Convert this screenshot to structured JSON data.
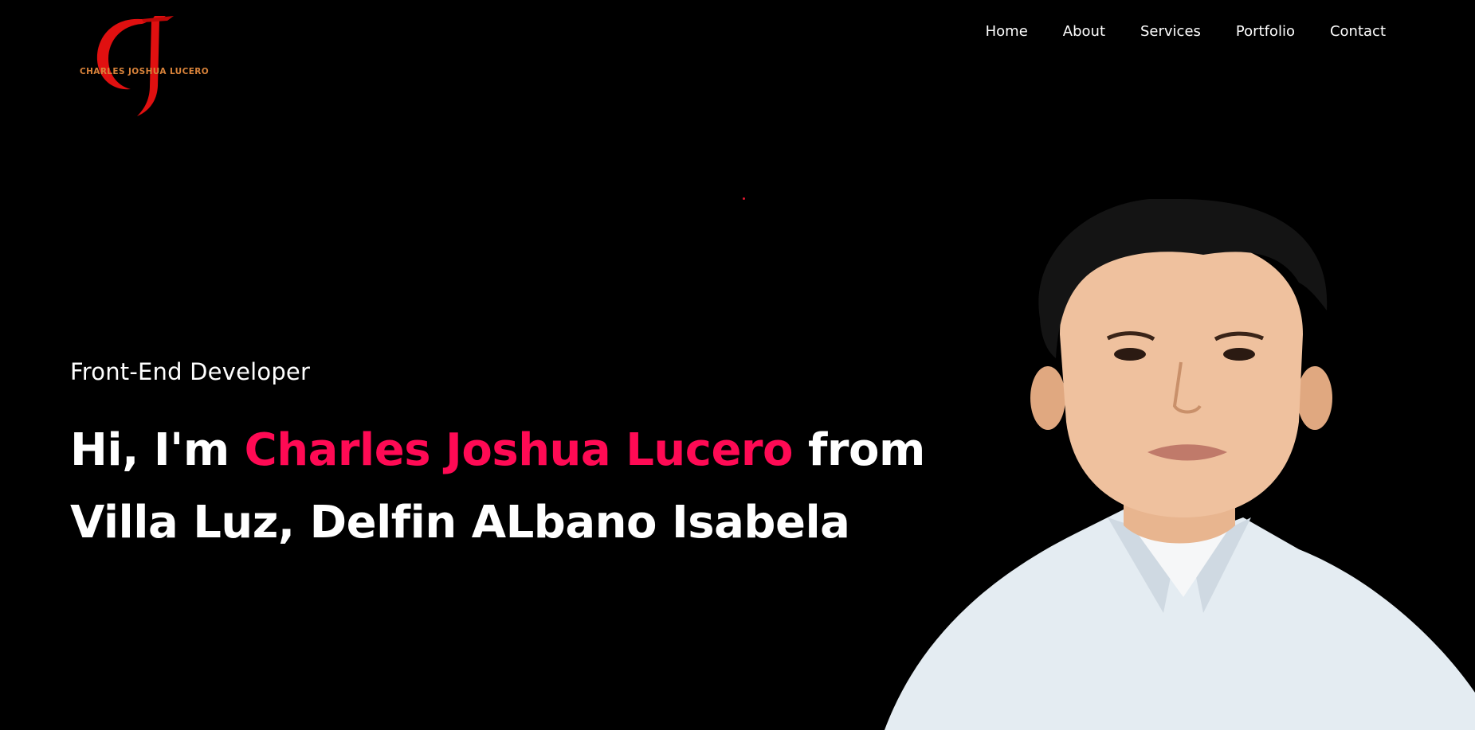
{
  "logo": {
    "text": "CHARLES JOSHUA LUCERO",
    "icon": "cj-monogram-logo",
    "accent_color": "#e01010",
    "text_color": "#d9833a"
  },
  "nav": {
    "items": [
      {
        "label": "Home"
      },
      {
        "label": "About"
      },
      {
        "label": "Services"
      },
      {
        "label": "Portfolio"
      },
      {
        "label": "Contact"
      }
    ]
  },
  "hero": {
    "subtitle": "Front-End Developer",
    "greeting": "Hi, I'm ",
    "name": "Charles Joshua Lucero",
    "rest_line1": " from",
    "rest_line2": "Villa Luz, Delfin ALbano Isabela",
    "name_color": "#ff0a54",
    "portrait": "profile-photo"
  }
}
